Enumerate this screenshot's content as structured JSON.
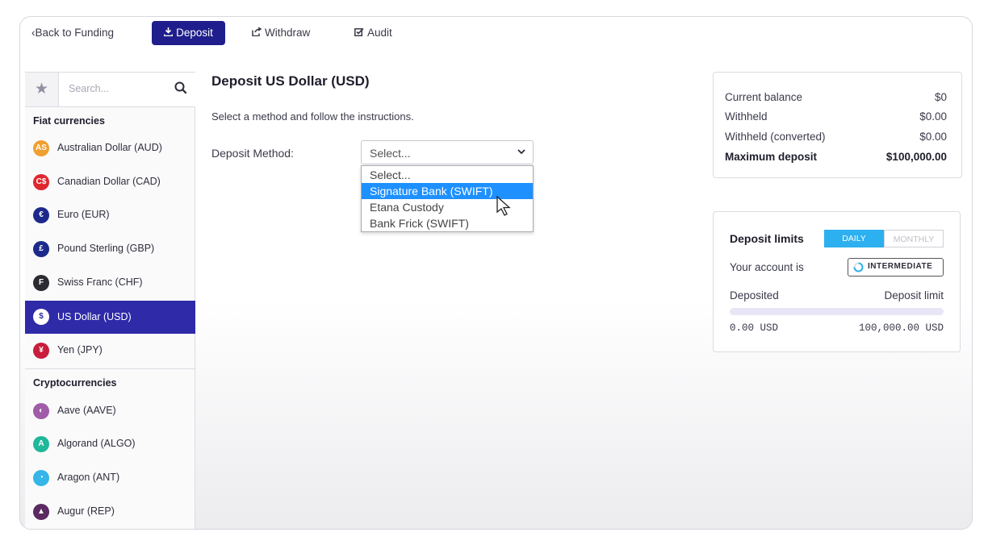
{
  "nav": {
    "back": "Back to Funding",
    "deposit": "Deposit",
    "withdraw": "Withdraw",
    "audit": "Audit"
  },
  "sidebar": {
    "search_placeholder": "Search...",
    "fiat_heading": "Fiat currencies",
    "fiat": [
      {
        "label": "Australian Dollar (AUD)",
        "icon": "AS",
        "color": "#f0a030"
      },
      {
        "label": "Canadian Dollar (CAD)",
        "icon": "C$",
        "color": "#e0262e"
      },
      {
        "label": "Euro (EUR)",
        "icon": "€",
        "color": "#1d2a8c"
      },
      {
        "label": "Pound Sterling (GBP)",
        "icon": "£",
        "color": "#1d2a8c"
      },
      {
        "label": "Swiss Franc (CHF)",
        "icon": "F",
        "color": "#2a2a30"
      },
      {
        "label": "US Dollar (USD)",
        "icon": "$",
        "color": "#2e2aa8"
      },
      {
        "label": "Yen (JPY)",
        "icon": "¥",
        "color": "#c81e3c"
      }
    ],
    "crypto_heading": "Cryptocurrencies",
    "crypto": [
      {
        "label": "Aave (AAVE)",
        "icon": "◐",
        "color": "#a05ca8"
      },
      {
        "label": "Algorand (ALGO)",
        "icon": "A",
        "color": "#1fb89a"
      },
      {
        "label": "Aragon (ANT)",
        "icon": "◔",
        "color": "#35b5e8"
      },
      {
        "label": "Augur (REP)",
        "icon": "▲",
        "color": "#5a2a60"
      }
    ]
  },
  "main": {
    "title": "Deposit US Dollar (USD)",
    "subtitle": "Select a method and follow the instructions.",
    "method_label": "Deposit Method:",
    "select_value": "Select...",
    "options": [
      "Select...",
      "Signature Bank (SWIFT)",
      "Etana Custody",
      "Bank Frick (SWIFT)"
    ]
  },
  "balance": {
    "rows": [
      {
        "label": "Current balance",
        "value": "$0"
      },
      {
        "label": "Withheld",
        "value": "$0.00"
      },
      {
        "label": "Withheld (converted)",
        "value": "$0.00"
      },
      {
        "label": "Maximum deposit",
        "value": "$100,000.00"
      }
    ]
  },
  "limits": {
    "title": "Deposit limits",
    "daily": "DAILY",
    "monthly": "MONTHLY",
    "account_label": "Your account is",
    "level": "INTERMEDIATE",
    "deposited_label": "Deposited",
    "limit_label": "Deposit limit",
    "deposited_amount": "0.00 USD",
    "limit_amount": "100,000.00 USD",
    "progress": 0
  },
  "colors": {
    "accent": "#2e2aa8",
    "nav_active": "#1f1e8c",
    "toggle_active": "#2db0ef",
    "dropdown_highlight": "#1e90ff"
  }
}
